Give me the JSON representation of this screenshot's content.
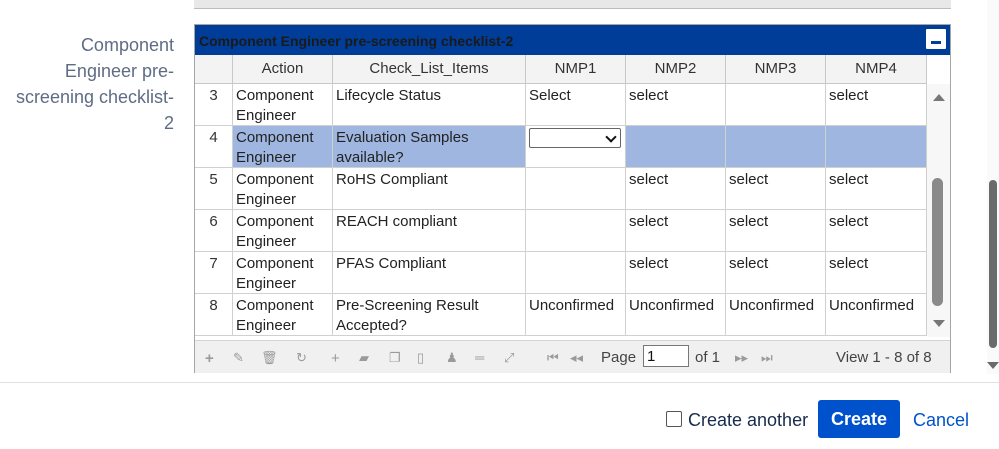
{
  "field_label": "Component Engineer pre-screening checklist-2",
  "grid": {
    "title": "Component Engineer pre-screening checklist-2",
    "columns": [
      "",
      "Action",
      "Check_List_Items",
      "NMP1",
      "NMP2",
      "NMP3",
      "NMP4"
    ],
    "rows": [
      {
        "num": "3",
        "action": "Component Engineer",
        "item": "Lifecycle Status",
        "nmp1": "Select",
        "nmp2": "select",
        "nmp3": "",
        "nmp4": "select"
      },
      {
        "num": "4",
        "action": "Component Engineer",
        "item": "Evaluation Samples available?",
        "nmp1": "",
        "nmp2": "",
        "nmp3": "",
        "nmp4": ""
      },
      {
        "num": "5",
        "action": "Component Engineer",
        "item": "RoHS Compliant",
        "nmp1": "",
        "nmp2": "select",
        "nmp3": "select",
        "nmp4": "select"
      },
      {
        "num": "6",
        "action": "Component Engineer",
        "item": "REACH compliant",
        "nmp1": "",
        "nmp2": "select",
        "nmp3": "select",
        "nmp4": "select"
      },
      {
        "num": "7",
        "action": "Component Engineer",
        "item": "PFAS Compliant",
        "nmp1": "",
        "nmp2": "select",
        "nmp3": "select",
        "nmp4": "select"
      },
      {
        "num": "8",
        "action": "Component Engineer",
        "item": "Pre-Screening Result Accepted?",
        "nmp1": "Unconfirmed",
        "nmp2": "Unconfirmed",
        "nmp3": "Unconfirmed",
        "nmp4": "Unconfirmed"
      }
    ],
    "pager": {
      "page_label": "Page",
      "page_value": "1",
      "of_label": "of 1",
      "view_text": "View 1 - 8 of 8"
    }
  },
  "footer": {
    "create_another_label": "Create another",
    "create_label": "Create",
    "cancel_label": "Cancel"
  },
  "colors": {
    "title_bar": "#003d99",
    "selected_row": "#9eb6e0",
    "primary_button": "#0052cc"
  }
}
